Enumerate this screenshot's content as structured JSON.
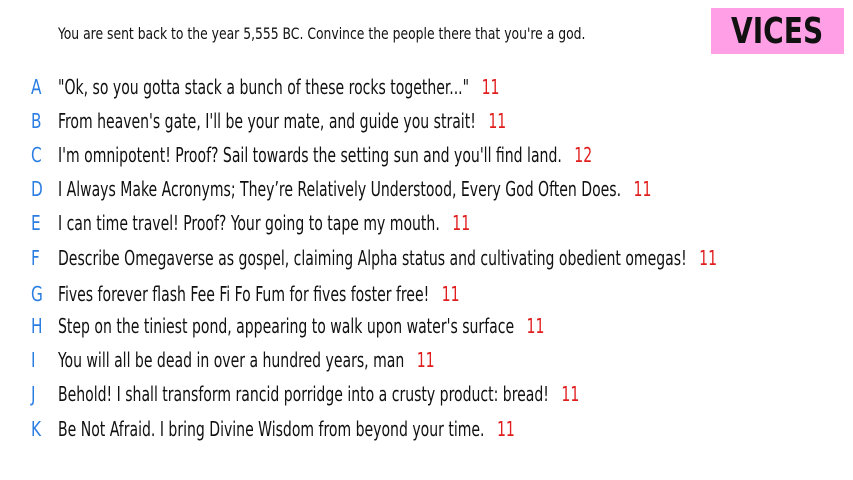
{
  "prompt": "You are sent back to the year 5,555 BC. Convince the people there that you're a god.",
  "badge": "VICES",
  "answers": [
    {
      "letter": "A",
      "text": "\"Ok, so you gotta stack a bunch of these rocks together...\"",
      "score": "11"
    },
    {
      "letter": "B",
      "text": "From heaven's gate, I'll be your mate, and guide you strait!",
      "score": "11"
    },
    {
      "letter": "C",
      "text": "I'm omnipotent! Proof? Sail towards the setting sun and you'll find land.",
      "score": "12"
    },
    {
      "letter": "D",
      "text": "I Always Make Acronyms; They’re Relatively Understood, Every God Often Does.",
      "score": "11"
    },
    {
      "letter": "E",
      "text": "I can time travel! Proof? Your going to tape my mouth.",
      "score": "11"
    },
    {
      "letter": "F",
      "text": "Describe Omegaverse as gospel, claiming Alpha status and cultivating obedient omegas!",
      "score": "11"
    },
    {
      "letter": "G",
      "text": "Fives forever flash Fee Fi Fo Fum for fives foster free!",
      "score": "11"
    },
    {
      "letter": "H",
      "text": "Step on the tiniest pond, appearing to walk upon water's surface",
      "score": "11"
    },
    {
      "letter": "I",
      "text": "You will all be dead in over a hundred years, man",
      "score": "11"
    },
    {
      "letter": "J",
      "text": "Behold! I shall transform rancid porridge into a crusty product: bread!",
      "score": "11"
    },
    {
      "letter": "K",
      "text": "Be Not Afraid. I bring Divine Wisdom from beyond your time.",
      "score": "11"
    }
  ],
  "colors": {
    "letter": "#2a7de1",
    "score": "#e01e1e",
    "badge_bg": "#ff9fe6",
    "text": "#111111"
  }
}
